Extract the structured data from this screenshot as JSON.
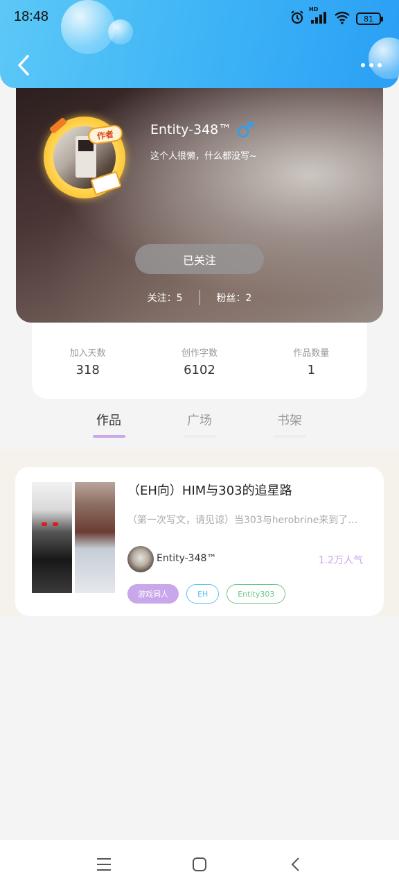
{
  "status_bar": {
    "time": "18:48",
    "network_label": "HD",
    "battery": "81",
    "icons": [
      "alarm-icon",
      "signal-icon",
      "wifi-icon",
      "battery-icon"
    ]
  },
  "header": {
    "back_icon": "chevron-left-icon",
    "more_icon": "more-dots-icon",
    "accent_color": "#3fb5f6"
  },
  "profile": {
    "username": "Entity-348™",
    "gender_icon": "male-icon",
    "badge": "作者",
    "bio": "这个人很懒，什么都没写~",
    "follow_button": "已关注",
    "following": "关注：5",
    "followers": "粉丝：2"
  },
  "stats": [
    {
      "label": "加入天数",
      "value": "318"
    },
    {
      "label": "创作字数",
      "value": "6102"
    },
    {
      "label": "作品数量",
      "value": "1"
    }
  ],
  "tabs": [
    {
      "label": "作品",
      "active": true
    },
    {
      "label": "广场",
      "active": false
    },
    {
      "label": "书架",
      "active": false
    }
  ],
  "works": [
    {
      "title": "（EH向）HIM与303的追星路",
      "description": "（第一次写文，请见谅）当303与herobrine来到了…",
      "author": "Entity-348™",
      "popularity": "1.2万人气",
      "tags": [
        "游戏同人",
        "EH",
        "Entity303"
      ]
    }
  ],
  "nav_bar": {
    "icons": [
      "menu-icon",
      "home-icon",
      "back-icon"
    ]
  },
  "colors": {
    "tag_primary": "#c8a7ea",
    "tag_blue": "#59c4ef",
    "tag_green": "#6bc77f"
  }
}
